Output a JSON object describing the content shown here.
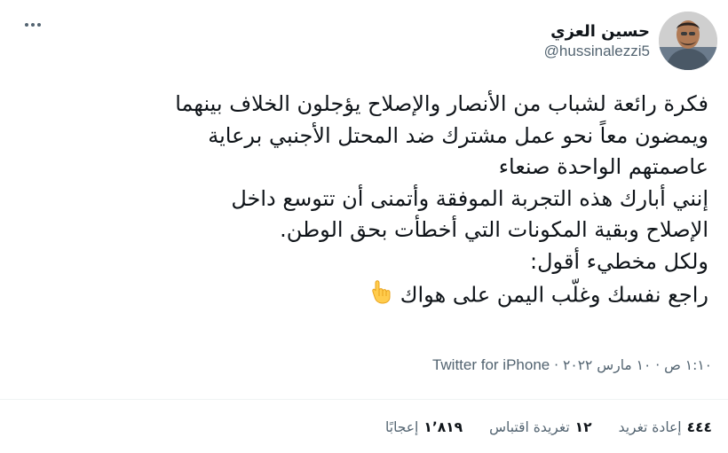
{
  "author": {
    "display_name": "حسين العزي",
    "handle": "@hussinalezzi5"
  },
  "tweet": {
    "lines": [
      "فكرة رائعة لشباب من الأنصار والإصلاح يؤجلون الخلاف بينهما",
      "ويمضون معاً نحو عمل مشترك ضد المحتل الأجنبي برعاية",
      "عاصمتهم الواحدة صنعاء",
      "إنني أبارك هذه التجربة الموفقة وأتمنى أن تتوسع داخل",
      "الإصلاح وبقية المكونات التي أخطأت بحق الوطن.",
      "ولكل مخطيء أقول:",
      "راجع نفسك وغلّب اليمن على هواك"
    ],
    "emoji_icon": "pointing-hand-emoji"
  },
  "meta": {
    "time": "١:١٠ ص",
    "separator": "·",
    "date": "١٠ مارس ٢٠٢٢",
    "source": "Twitter for iPhone"
  },
  "stats": {
    "retweets": {
      "count": "٤٤٤",
      "label": "إعادة تغريد"
    },
    "quotes": {
      "count": "١٢",
      "label": "تغريدة اقتباس"
    },
    "likes": {
      "count": "١٬٨١٩",
      "label": "إعجابًا"
    }
  },
  "icons": {
    "more": "more-options-icon",
    "emoji": "pointing-hand-emoji"
  },
  "colors": {
    "text": "#0f1419",
    "secondary": "#536471",
    "divider": "#eff3f4",
    "emoji": "#ffcc4d"
  }
}
